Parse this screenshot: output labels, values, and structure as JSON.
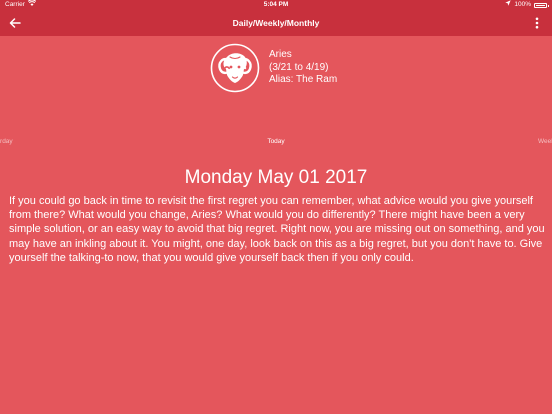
{
  "status_bar": {
    "carrier": "Carrier",
    "time": "5:04 PM",
    "battery_percent": "100%",
    "battery_level": 1.0,
    "icons": [
      "wifi-icon",
      "location-arrow-icon",
      "battery-icon"
    ]
  },
  "nav": {
    "title": "Daily/Weekly/Monthly",
    "back_icon": "arrow-left-icon",
    "more_icon": "more-vertical-icon"
  },
  "sign": {
    "name": "Aries",
    "dates": "(3/21 to 4/19)",
    "alias": "Alias: The Ram",
    "emblem_icon": "ram-icon"
  },
  "tabs": {
    "prev": "Yesterday",
    "current": "Today",
    "next": "Weekly"
  },
  "reading": {
    "date": "Monday May 01 2017",
    "text": "If you could go back in time to revisit the first regret you can remember, what advice would you give yourself from there? What would you change, Aries? What would you do differently? There might have been a very simple solution, or an easy way to avoid that big regret. Right now, you are missing out on something, and you may have an inkling about it. You might, one day, look back on this as a big regret, but you don't have to. Give yourself the talking-to now, that you would give yourself back then if you only could."
  },
  "colors": {
    "background": "#e4565c",
    "bar": "#c8303d",
    "text": "#ffffff"
  }
}
